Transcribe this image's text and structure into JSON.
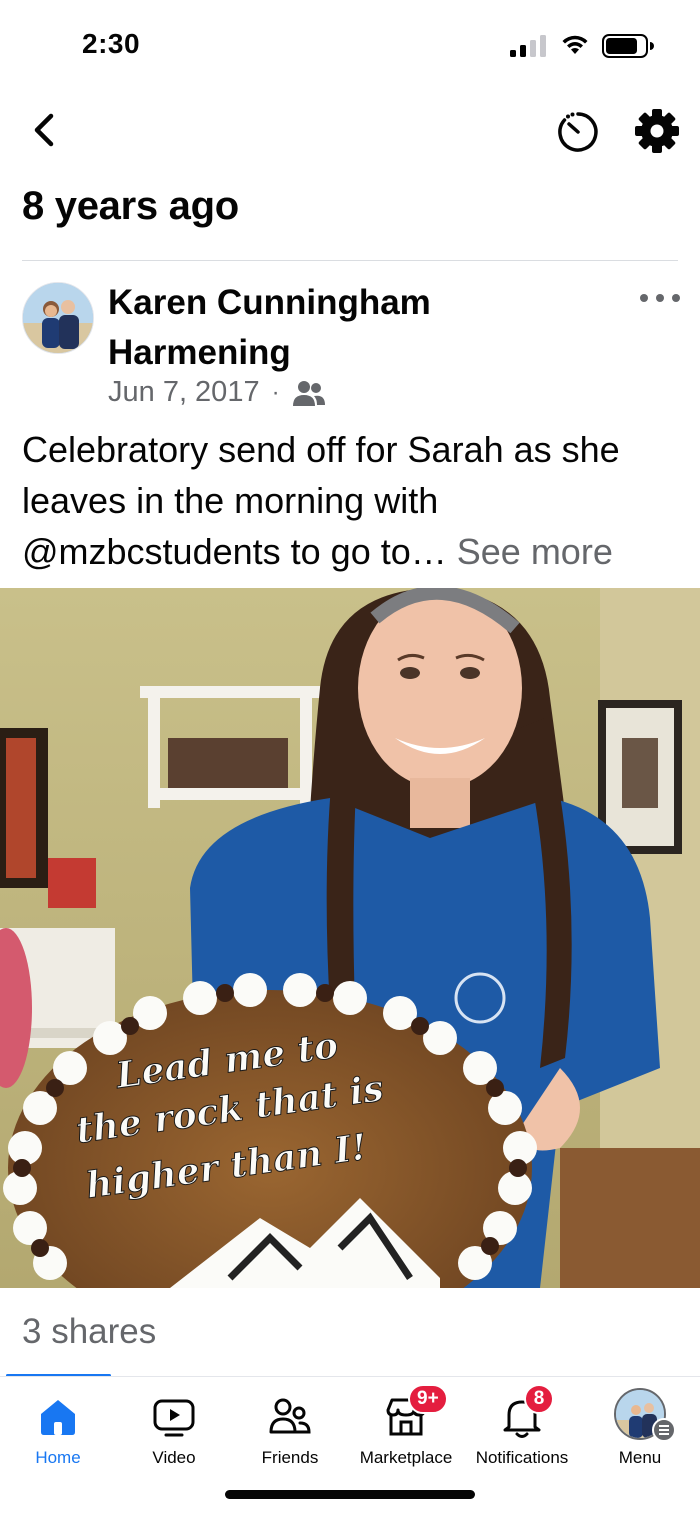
{
  "status_bar": {
    "time": "2:30"
  },
  "header": {
    "back_icon": "chevron-left-icon",
    "timer_icon": "stopwatch-icon",
    "settings_icon": "gear-icon"
  },
  "memory": {
    "title": "8 years ago"
  },
  "post": {
    "author": "Karen Cunningham Harmening",
    "date": "Jun 7, 2017",
    "separator": "·",
    "audience_icon": "friends-icon",
    "text": "Celebratory send off for Sarah as she leaves in the morning with @mzbcstudents to go to…",
    "see_more": "See more",
    "photo_cookie_text": [
      "Lead me to",
      "the rock that is",
      "higher than I!"
    ],
    "shares": "3 shares"
  },
  "nav": {
    "items": [
      {
        "label": "Home",
        "icon": "home-icon",
        "active": true
      },
      {
        "label": "Video",
        "icon": "video-icon"
      },
      {
        "label": "Friends",
        "icon": "friends-icon"
      },
      {
        "label": "Marketplace",
        "icon": "marketplace-icon",
        "badge": "9+"
      },
      {
        "label": "Notifications",
        "icon": "bell-icon",
        "badge": "8"
      },
      {
        "label": "Menu",
        "icon": "menu-icon"
      }
    ]
  },
  "colors": {
    "accent": "#1877f2",
    "badge": "#e41e3f",
    "secondary_text": "#65676b"
  }
}
